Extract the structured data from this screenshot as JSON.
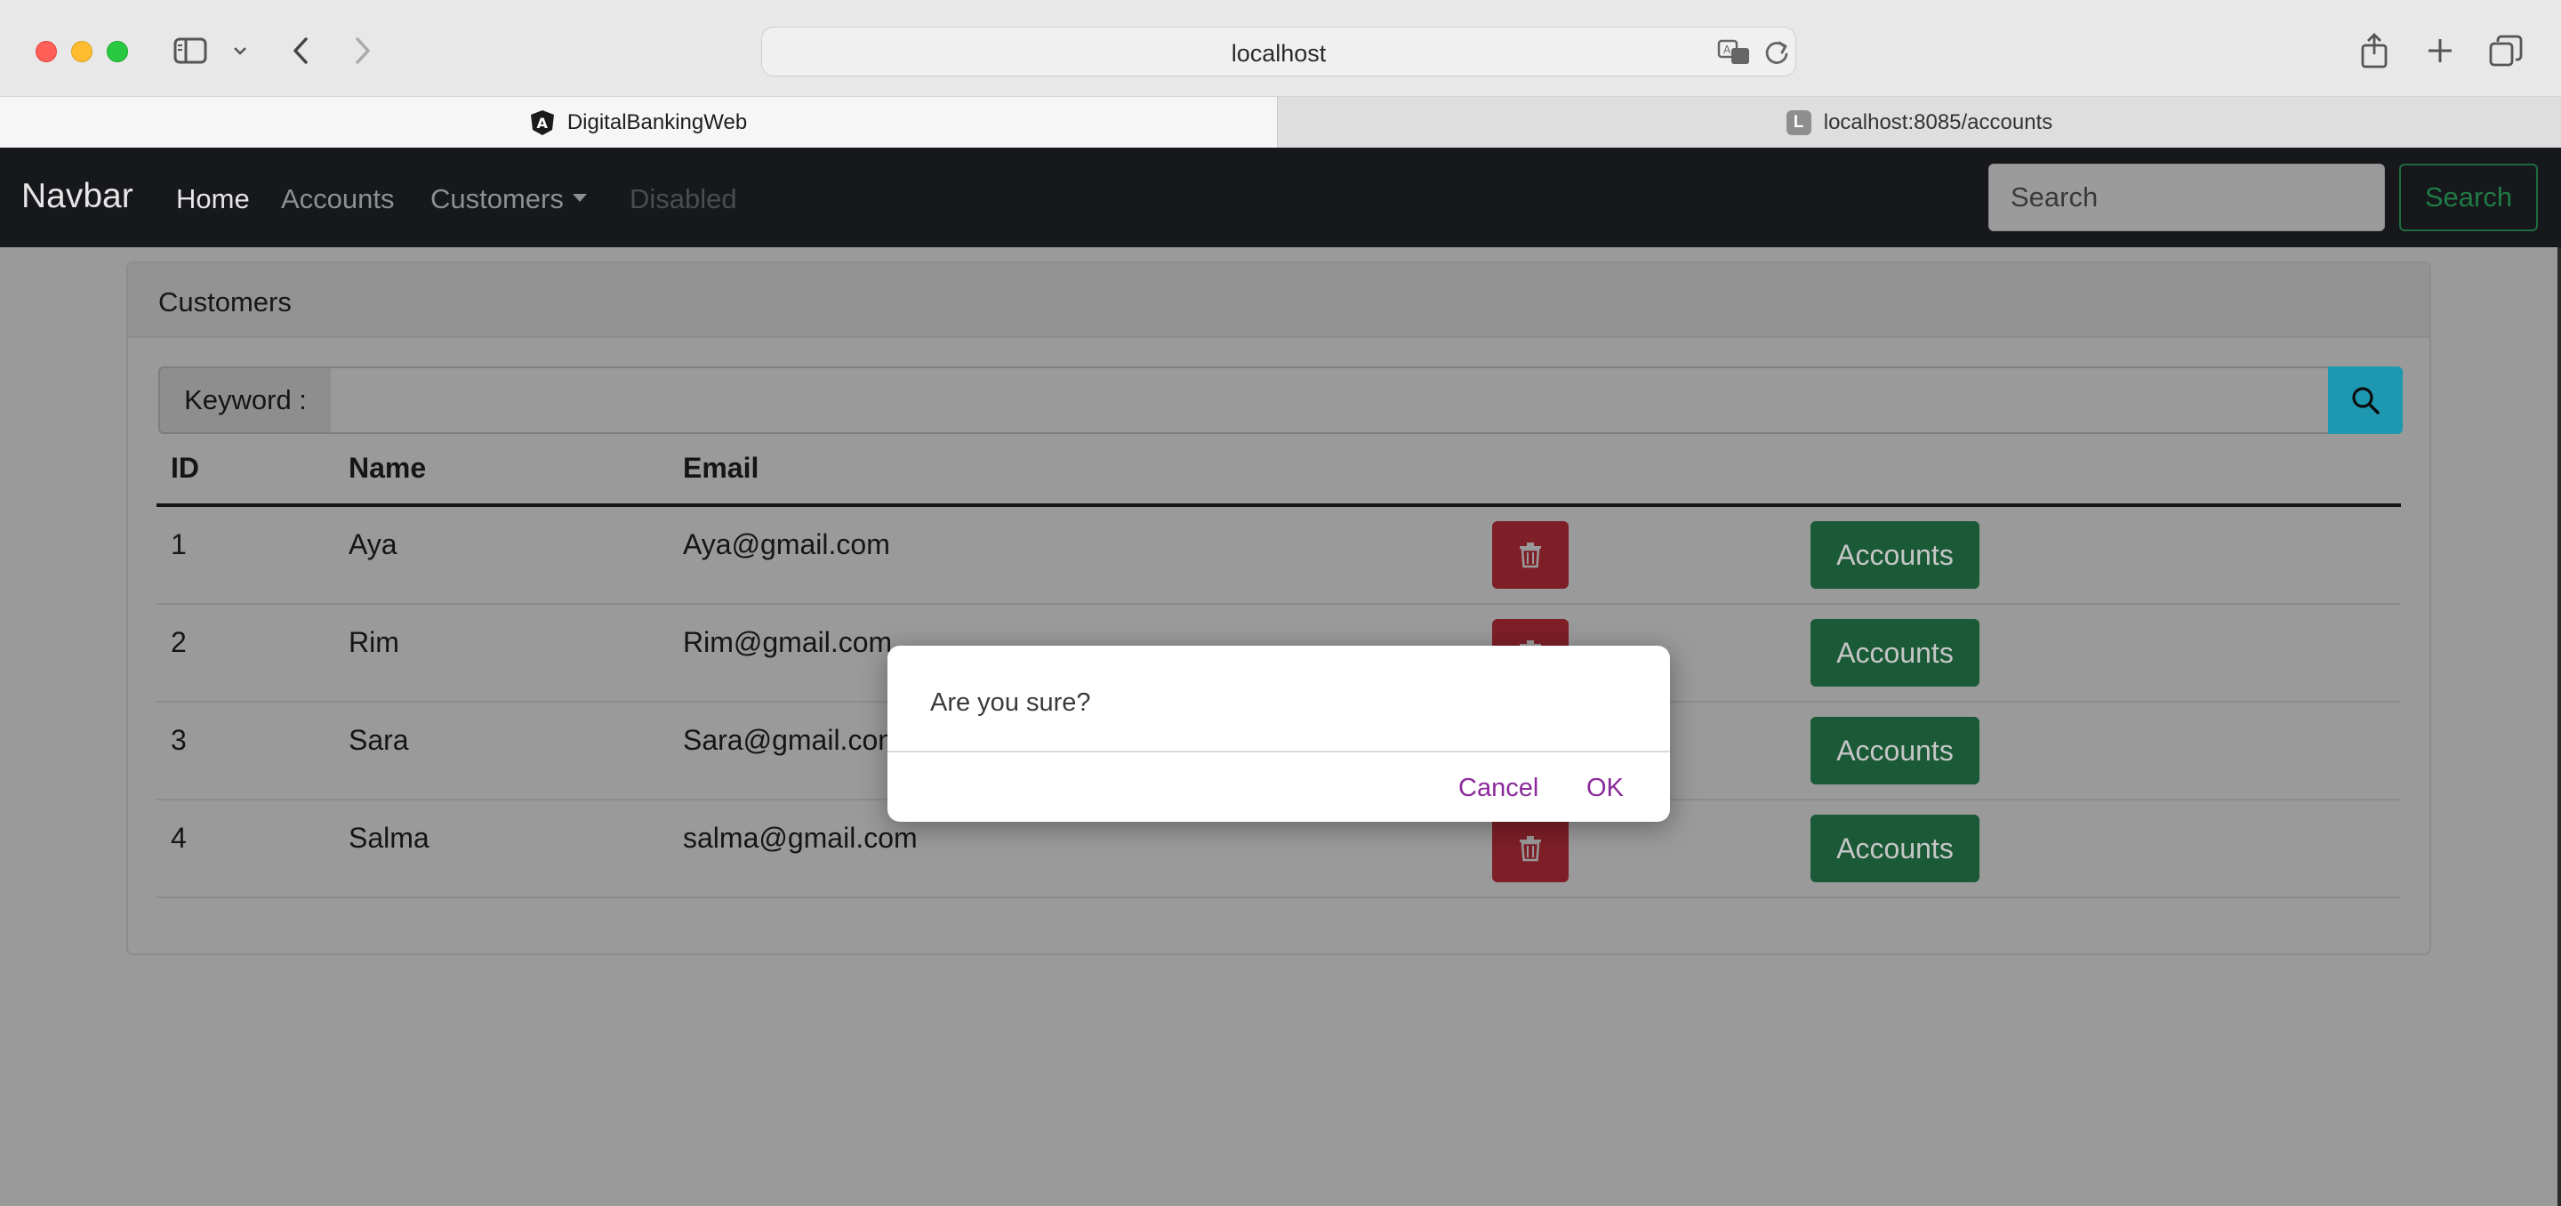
{
  "browser": {
    "address": "localhost",
    "tabs": [
      {
        "title": "DigitalBankingWeb",
        "favicon": "angular-icon",
        "active": true
      },
      {
        "title": "localhost:8085/accounts",
        "favicon_letter": "L",
        "active": false
      }
    ]
  },
  "navbar": {
    "brand": "Navbar",
    "links": [
      {
        "label": "Home",
        "state": "active"
      },
      {
        "label": "Accounts",
        "state": "normal"
      },
      {
        "label": "Customers",
        "state": "dropdown"
      },
      {
        "label": "Disabled",
        "state": "disabled"
      }
    ],
    "search_placeholder": "Search",
    "search_button": "Search"
  },
  "customers": {
    "title": "Customers",
    "keyword_label": "Keyword :",
    "keyword_value": "",
    "columns": [
      "ID",
      "Name",
      "Email"
    ],
    "rows": [
      {
        "id": "1",
        "name": "Aya",
        "email": "Aya@gmail.com",
        "action": "Accounts"
      },
      {
        "id": "2",
        "name": "Rim",
        "email": "Rim@gmail.com",
        "action": "Accounts"
      },
      {
        "id": "3",
        "name": "Sara",
        "email": "Sara@gmail.com",
        "action": "Accounts"
      },
      {
        "id": "4",
        "name": "Salma",
        "email": "salma@gmail.com",
        "action": "Accounts"
      }
    ]
  },
  "dialog": {
    "message": "Are you sure?",
    "cancel": "Cancel",
    "ok": "OK"
  },
  "colors": {
    "navbar_bg": "#212529",
    "danger": "#dc3545",
    "success": "#198754",
    "info": "#0dcaf0",
    "dialog_button": "#8a2a9a"
  }
}
